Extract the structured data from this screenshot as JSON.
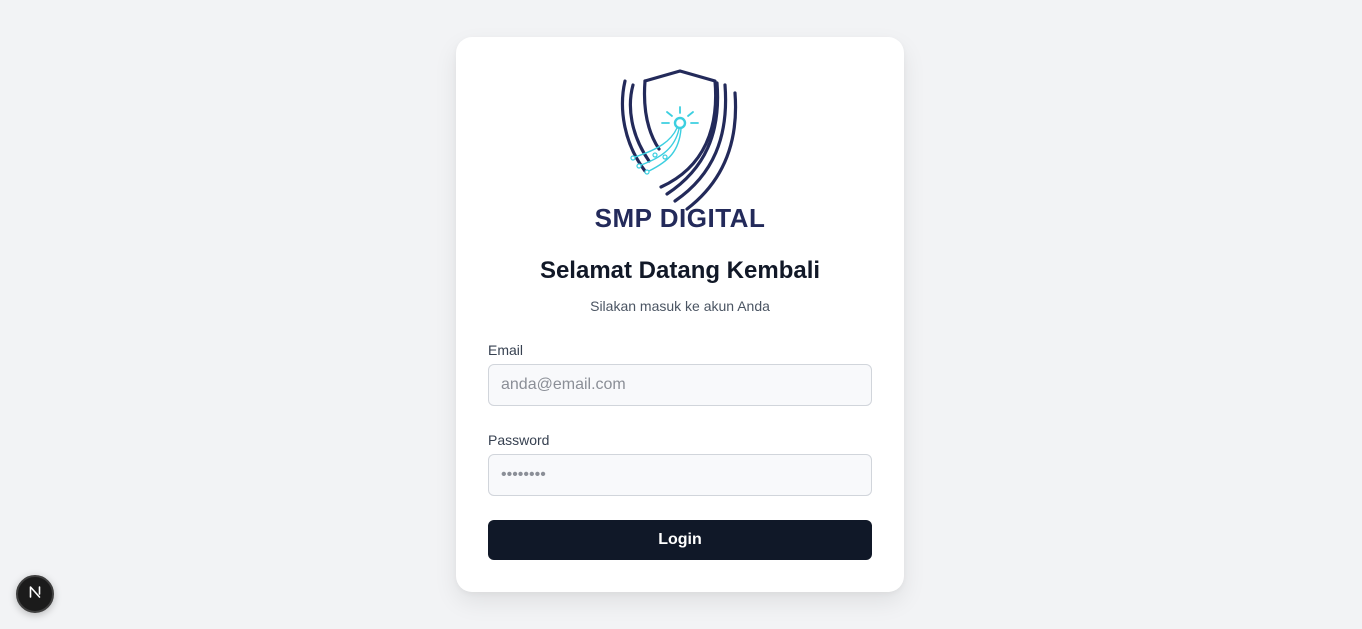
{
  "logo": {
    "brand_text": "SMP DIGITAL",
    "icon": "shield-circuit-logo",
    "colors": {
      "navy": "#232a5a",
      "cyan": "#3ccfe0"
    }
  },
  "login": {
    "title": "Selamat Datang Kembali",
    "subtitle": "Silakan masuk ke akun Anda",
    "email_label": "Email",
    "email_placeholder": "anda@email.com",
    "email_value": "",
    "password_label": "Password",
    "password_placeholder": "••••••••",
    "password_value": "",
    "submit_label": "Login"
  },
  "dev_badge": {
    "letter": "N",
    "icon": "nextjs-icon"
  },
  "colors": {
    "background": "#f2f3f5",
    "card": "#ffffff",
    "primary_button": "#101828",
    "heading": "#111827"
  }
}
